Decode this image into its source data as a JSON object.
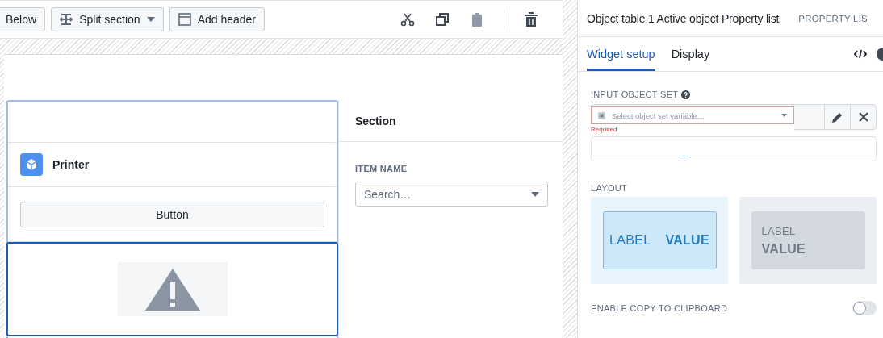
{
  "toolbar": {
    "buttons": [
      {
        "label": "Below",
        "kind": "plain"
      },
      {
        "label": "Split section",
        "kind": "split"
      },
      {
        "label": "Add header",
        "kind": "header"
      }
    ],
    "actions": [
      {
        "kind": "cut",
        "disabled": false
      },
      {
        "kind": "copy",
        "disabled": false
      },
      {
        "kind": "paste",
        "disabled": true
      },
      {
        "kind": "delete",
        "disabled": false
      }
    ]
  },
  "canvas": {
    "widget": {
      "title": "Printer",
      "button": "Button"
    },
    "section": {
      "title": "Section",
      "field_label": "ITEM NAME",
      "placeholder": "Search…"
    }
  },
  "panel": {
    "title": "Object table 1 Active object Property list",
    "badge": "PROPERTY LIS",
    "tabs": [
      {
        "label": "Widget setup",
        "selected": true
      },
      {
        "label": "Display",
        "selected": false
      }
    ],
    "input_label": "INPUT OBJECT SET",
    "dropdown_placeholder": "Select object set variable…",
    "error": "Required",
    "layout_label": "LAYOUT",
    "layouts": [
      {
        "kind": "inline",
        "label": "LABEL",
        "value": "VALUE",
        "selected": true
      },
      {
        "kind": "stacked",
        "label": "LABEL",
        "value": "VALUE",
        "selected": false
      }
    ],
    "toggles": [
      {
        "label": "ENABLE COPY TO CLIPBOARD",
        "on": false
      }
    ]
  }
}
